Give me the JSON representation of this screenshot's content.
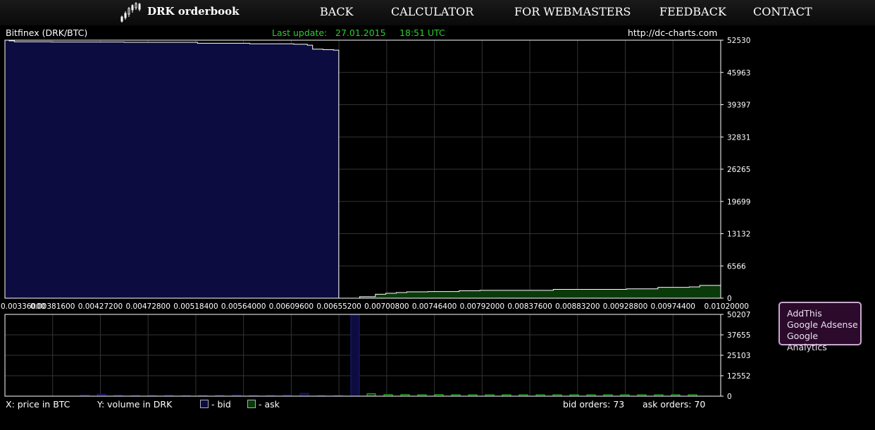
{
  "header": {
    "title": "DRK orderbook",
    "nav": [
      "BACK",
      "CALCULATOR",
      "FOR WEBMASTERS",
      "FEEDBACK",
      "CONTACT"
    ]
  },
  "info": {
    "exchange": "Bitfinex (DRK/BTC)",
    "last_update_label": "Last update:",
    "date": "27.01.2015",
    "time": "18:51 UTC",
    "site": "http://dc-charts.com"
  },
  "footer": {
    "x_axis": "X: price in BTC",
    "y_axis": "Y: volume in DRK",
    "bid_label": "- bid",
    "ask_label": "- ask",
    "bid_orders": "bid orders: 73",
    "ask_orders": "ask orders: 70"
  },
  "promo": [
    "AddThis",
    "Google Adsense",
    "Google Analytics"
  ],
  "colors": {
    "bid_fill": "#0c0c40",
    "bid_bar": "#1b1b8a",
    "ask_fill": "#0a3a0a",
    "ask_bar": "#2eb82e",
    "grid": "#333333"
  },
  "chart_data": [
    {
      "type": "area",
      "title": "",
      "x_ticks": [
        "0.00336000",
        "0.00381600",
        "0.00427200",
        "0.00472800",
        "0.00518400",
        "0.00564000",
        "0.00609600",
        "0.00655200",
        "0.00700800",
        "0.00746400",
        "0.00792000",
        "0.00837600",
        "0.00883200",
        "0.00928800",
        "0.00974400",
        "0.01020000"
      ],
      "y_ticks": [
        "0",
        "6566",
        "13132",
        "19699",
        "26265",
        "32831",
        "39397",
        "45963",
        "52530"
      ],
      "xlim": [
        0.00336,
        0.0102
      ],
      "ylim": [
        0,
        52530
      ],
      "series": [
        {
          "name": "bid",
          "points": [
            [
              0.00336,
              52530
            ],
            [
              0.0034,
              52400
            ],
            [
              0.00345,
              52200
            ],
            [
              0.0038,
              52150
            ],
            [
              0.0045,
              52100
            ],
            [
              0.0052,
              51900
            ],
            [
              0.0057,
              51800
            ],
            [
              0.00612,
              51700
            ],
            [
              0.00625,
              51500
            ],
            [
              0.0063,
              50700
            ],
            [
              0.0064,
              50600
            ],
            [
              0.0065,
              50500
            ],
            [
              0.00655,
              0
            ]
          ]
        },
        {
          "name": "ask",
          "points": [
            [
              0.00672,
              0
            ],
            [
              0.00675,
              300
            ],
            [
              0.0069,
              800
            ],
            [
              0.007,
              1000
            ],
            [
              0.0071,
              1150
            ],
            [
              0.0072,
              1300
            ],
            [
              0.0074,
              1350
            ],
            [
              0.0077,
              1500
            ],
            [
              0.0079,
              1600
            ],
            [
              0.0086,
              1800
            ],
            [
              0.0093,
              1900
            ],
            [
              0.0096,
              2200
            ],
            [
              0.0099,
              2300
            ],
            [
              0.01,
              2600
            ],
            [
              0.0102,
              2600
            ]
          ]
        }
      ]
    },
    {
      "type": "bar",
      "title": "",
      "y_ticks": [
        "0",
        "12552",
        "25103",
        "37655",
        "50207"
      ],
      "ylim": [
        0,
        50207
      ],
      "series": [
        {
          "name": "bid",
          "values": [
            700,
            1200,
            600,
            500,
            500,
            600,
            200,
            500,
            600,
            700,
            500,
            500,
            700,
            1700,
            300,
            400,
            50207
          ]
        },
        {
          "name": "ask",
          "values": [
            1500,
            1000,
            1000,
            900,
            1000,
            900,
            900,
            900,
            900,
            900,
            900,
            900,
            900,
            900,
            900,
            900,
            900,
            900,
            900,
            900
          ]
        }
      ]
    }
  ]
}
